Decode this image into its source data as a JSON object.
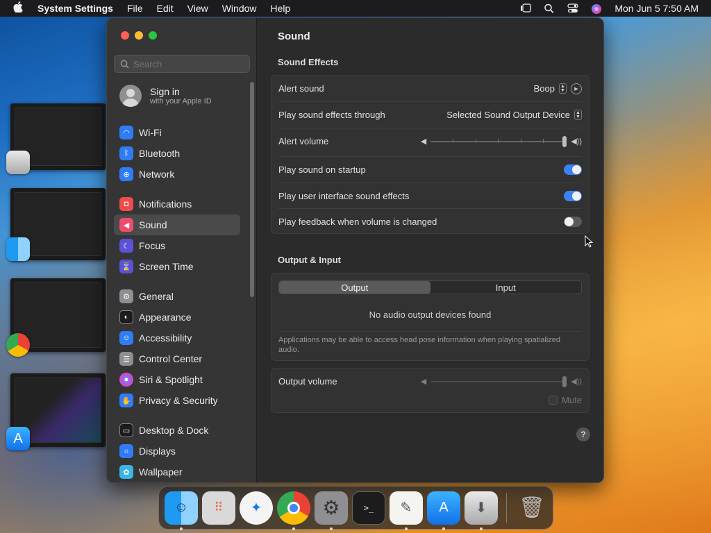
{
  "menubar": {
    "app_name": "System Settings",
    "menus": [
      "File",
      "Edit",
      "View",
      "Window",
      "Help"
    ],
    "clock": "Mon Jun 5  7:50 AM"
  },
  "sidebar": {
    "search_placeholder": "Search",
    "signin_title": "Sign in",
    "signin_subtitle": "with your Apple ID",
    "items": [
      {
        "label": "Wi-Fi",
        "color": "#2f7cf6",
        "icon": "wifi-icon"
      },
      {
        "label": "Bluetooth",
        "color": "#2f7cf6",
        "icon": "bluetooth-icon"
      },
      {
        "label": "Network",
        "color": "#2f7cf6",
        "icon": "globe-icon"
      },
      {
        "label": "Notifications",
        "color": "#ef4b4b",
        "icon": "bell-icon"
      },
      {
        "label": "Sound",
        "color": "#ef4b6b",
        "icon": "speaker-icon"
      },
      {
        "label": "Focus",
        "color": "#5b52d8",
        "icon": "moon-icon"
      },
      {
        "label": "Screen Time",
        "color": "#5b52d8",
        "icon": "hourglass-icon"
      },
      {
        "label": "General",
        "color": "#8e8e93",
        "icon": "gear-icon"
      },
      {
        "label": "Appearance",
        "color": "#1c1c1e",
        "icon": "appearance-icon"
      },
      {
        "label": "Accessibility",
        "color": "#2f7cf6",
        "icon": "accessibility-icon"
      },
      {
        "label": "Control Center",
        "color": "#8e8e93",
        "icon": "control-center-icon"
      },
      {
        "label": "Siri & Spotlight",
        "color": "#c04be0",
        "icon": "siri-icon"
      },
      {
        "label": "Privacy & Security",
        "color": "#2f7cf6",
        "icon": "hand-icon"
      },
      {
        "label": "Desktop & Dock",
        "color": "#1c1c1e",
        "icon": "dock-icon"
      },
      {
        "label": "Displays",
        "color": "#2f7cf6",
        "icon": "sun-icon"
      },
      {
        "label": "Wallpaper",
        "color": "#3ab5e6",
        "icon": "wallpaper-icon"
      }
    ],
    "selected": "Sound"
  },
  "content": {
    "title": "Sound",
    "sound_effects": {
      "heading": "Sound Effects",
      "alert_sound_label": "Alert sound",
      "alert_sound_value": "Boop",
      "play_through_label": "Play sound effects through",
      "play_through_value": "Selected Sound Output Device",
      "alert_volume_label": "Alert volume",
      "alert_volume_level": 1.0,
      "startup_label": "Play sound on startup",
      "startup_on": true,
      "ui_effects_label": "Play user interface sound effects",
      "ui_effects_on": true,
      "feedback_label": "Play feedback when volume is changed",
      "feedback_on": false
    },
    "output_input": {
      "heading": "Output & Input",
      "tab_output": "Output",
      "tab_input": "Input",
      "active_tab": "Output",
      "empty_message": "No audio output devices found",
      "note": "Applications may be able to access head pose information when playing spatialized audio."
    },
    "output_volume": {
      "label": "Output volume",
      "level": 1.0,
      "mute_label": "Mute"
    },
    "help_glyph": "?"
  },
  "colors": {
    "accent": "#3a82f6",
    "close": "#ff5f57",
    "minimize": "#febc2e",
    "zoom": "#28c840"
  }
}
